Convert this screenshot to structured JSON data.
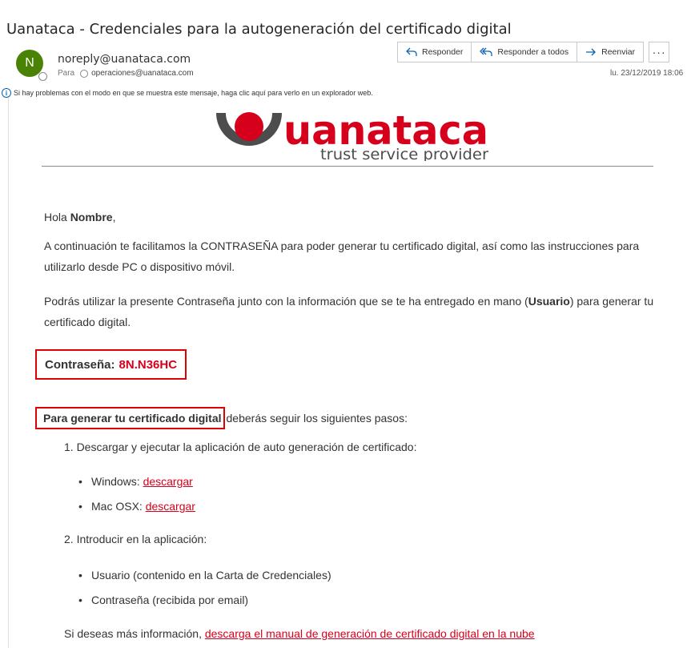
{
  "email": {
    "subject": "Uanataca - Credenciales para la autogeneración del certificado digital",
    "sender_initial": "N",
    "sender": "noreply@uanataca.com",
    "to_label": "Para",
    "recipient": "operaciones@uanataca.com",
    "date": "lu. 23/12/2019 18:06",
    "info_bar": "Si hay problemas con el modo en que se muestra este mensaje, haga clic aquí para verlo en un explorador web."
  },
  "actions": {
    "reply": "Responder",
    "reply_all": "Responder a todos",
    "forward": "Reenviar",
    "more": "···"
  },
  "logo": {
    "brand": "uanataca",
    "tagline": "trust service provider",
    "brand_color": "#d6001c",
    "ring_color": "#4d4d4d"
  },
  "content": {
    "greeting_prefix": "Hola ",
    "greeting_name": "Nombre",
    "greeting_suffix": ",",
    "p1": "A continuación te facilitamos la CONTRASEÑA para poder generar tu certificado digital, así como las instrucciones para utilizarlo desde PC o dispositivo móvil.",
    "p2_a": "Podrás utilizar la presente Contraseña junto con la información que se te ha entregado en mano (",
    "p2_bold": "Usuario",
    "p2_b": ") para generar tu certificado digital.",
    "password_label": "Contraseña:",
    "password_value": "8N.N36HC",
    "steps_bold": "Para generar tu certificado digital",
    "steps_rest": "deberás seguir los siguientes pasos:",
    "step1": "1. Descargar y ejecutar la aplicación de auto generación de certificado:",
    "windows_label": "Windows: ",
    "windows_link": "descargar",
    "mac_label": "Mac OSX: ",
    "mac_link": "descargar",
    "step2": "2. Introducir en la aplicación:",
    "item_user": "Usuario (contenido en la Carta de Credenciales)",
    "item_pass": "Contraseña (recibida por email)",
    "more_prefix": "Si deseas más información, ",
    "more_link": "descarga el manual de generación de certificado digital en la nube",
    "bullet": "•"
  },
  "colors": {
    "accent": "#d6001c",
    "highlight_box": "#e00000",
    "avatar": "#498205",
    "action_blue": "#0a63b0"
  }
}
